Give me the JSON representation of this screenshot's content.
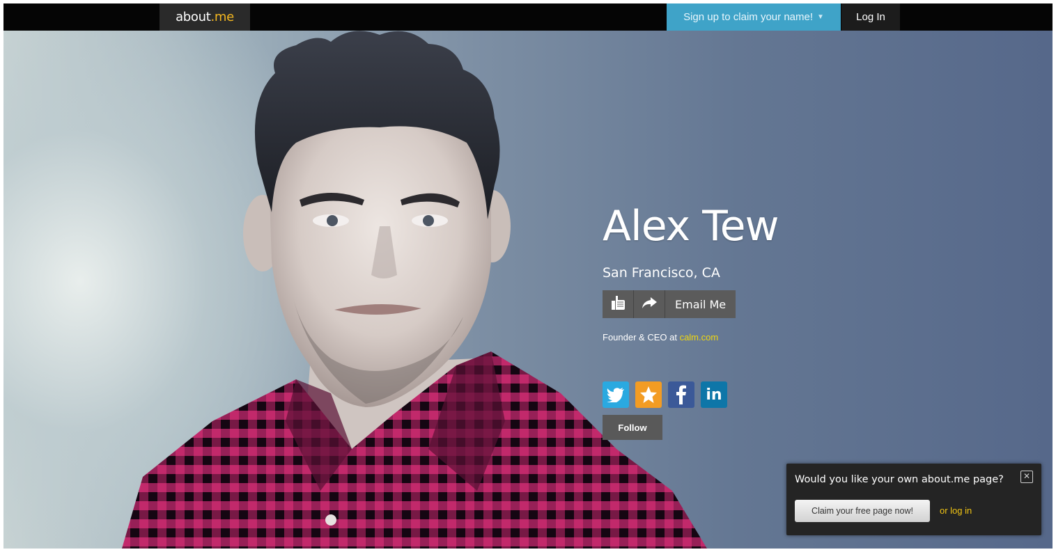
{
  "topbar": {
    "logo_main": "about",
    "logo_accent": ".me",
    "signup_label": "Sign up to claim your name!",
    "login_label": "Log In"
  },
  "profile": {
    "name": "Alex Tew",
    "location": "San Francisco, CA",
    "email_label": "Email Me",
    "bio_prefix": "Founder & CEO at ",
    "bio_link": "calm.com",
    "follow_label": "Follow",
    "social_icons": [
      "twitter-icon",
      "star-icon",
      "facebook-icon",
      "linkedin-icon"
    ]
  },
  "popup": {
    "question": "Would you like your own about.me page?",
    "claim_label": "Claim your free page now!",
    "login_link": "or log in"
  },
  "colors": {
    "topbar_bg": "#050505",
    "signup_bg": "#3fa3c8",
    "logo_accent": "#f5b820",
    "link_yellow": "#f1d80e",
    "twitter": "#2aa9e0",
    "star": "#f39c23",
    "facebook": "#3b5998",
    "linkedin": "#0e76a8"
  }
}
